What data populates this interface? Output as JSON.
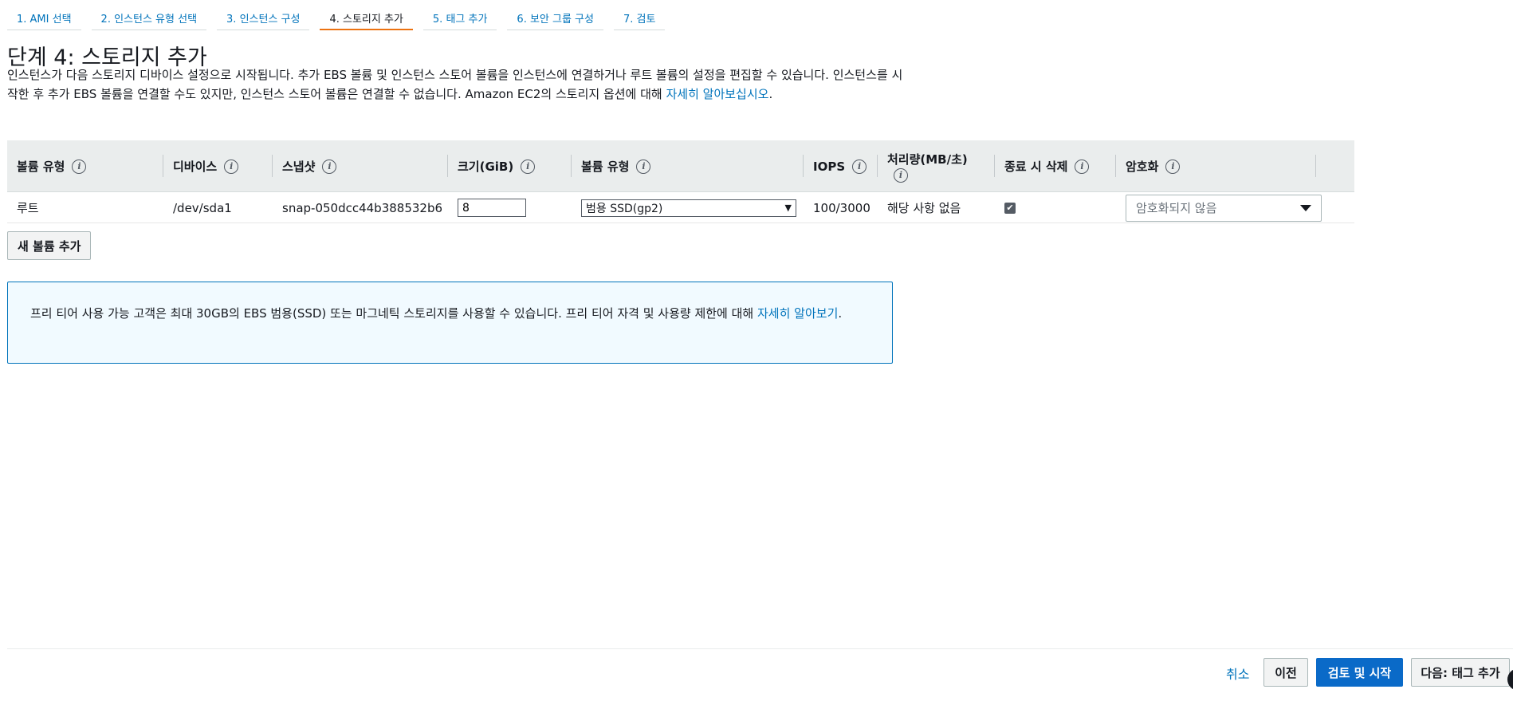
{
  "wizard": {
    "steps": [
      {
        "label": "1. AMI 선택"
      },
      {
        "label": "2. 인스턴스 유형 선택"
      },
      {
        "label": "3. 인스턴스 구성"
      },
      {
        "label": "4. 스토리지 추가"
      },
      {
        "label": "5. 태그 추가"
      },
      {
        "label": "6. 보안 그룹 구성"
      },
      {
        "label": "7. 검토"
      }
    ],
    "active_index": 3
  },
  "page": {
    "title": "단계 4: 스토리지 추가",
    "intro_text": "인스턴스가 다음 스토리지 디바이스 설정으로 시작됩니다. 추가 EBS 볼륨 및 인스턴스 스토어 볼륨을 인스턴스에 연결하거나 루트 볼륨의 설정을 편집할 수 있습니다. 인스턴스를 시작한 후 추가 EBS 볼륨을 연결할 수도 있지만, 인스턴스 스토어 볼륨은 연결할 수 없습니다. Amazon EC2의 스토리지 옵션에 대해 ",
    "intro_link": "자세히 알아보십시오",
    "intro_end": "."
  },
  "table": {
    "headers": {
      "volume_type": "볼륨 유형",
      "device": "디바이스",
      "snapshot": "스냅샷",
      "size": "크기(GiB)",
      "ebs_type": "볼륨 유형",
      "iops": "IOPS",
      "throughput": "처리량(MB/초)",
      "delete_on_termination": "종료 시 삭제",
      "encryption": "암호화"
    },
    "info_icon_glyph": "i",
    "rows": [
      {
        "volume_type": "루트",
        "device": "/dev/sda1",
        "snapshot": "snap-050dcc44b388532b6",
        "size": "8",
        "ebs_type": "범용 SSD(gp2)",
        "iops": "100/3000",
        "throughput": "해당 사항 없음",
        "delete_on_termination": true,
        "encryption": "암호화되지 않음"
      }
    ],
    "checkbox_glyph": "✔"
  },
  "add_volume_button": "새 볼륨 추가",
  "free_tier": {
    "text": "프리 티어 사용 가능 고객은 최대 30GB의 EBS 범용(SSD) 또는 마그네틱 스토리지를 사용할 수 있습니다. 프리 티어 자격 및 사용량 제한에 대해 ",
    "link": "자세히 알아보기",
    "end": "."
  },
  "footer": {
    "cancel": "취소",
    "previous": "이전",
    "review_and_launch": "검토 및 시작",
    "next": "다음: 태그 추가"
  },
  "colors": {
    "link": "#0073bb",
    "active_tab_underline": "#ec7211",
    "primary_button": "#0a6ac8",
    "info_box_bg": "#f1faff",
    "header_bg": "#eaeded"
  }
}
